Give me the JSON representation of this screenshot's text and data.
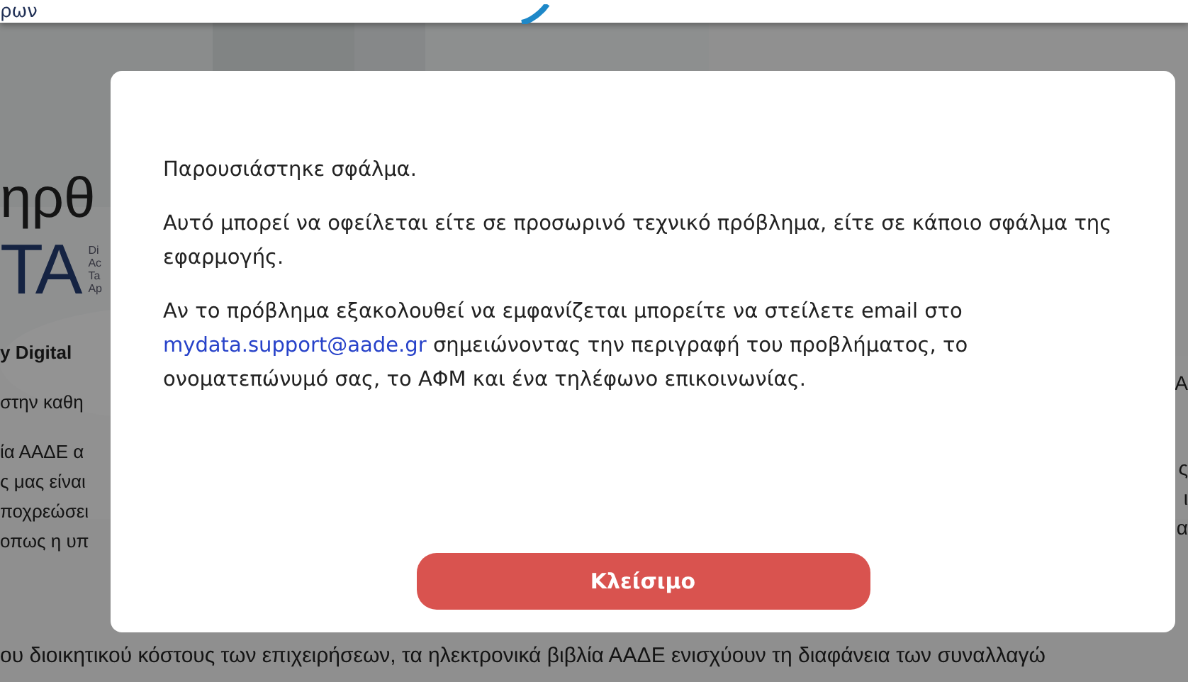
{
  "background_page": {
    "header_text": "ρων",
    "hero": {
      "title_fragment": "ηρθ",
      "logo_fragment": "TA",
      "logo_caption_lines": [
        "Di",
        "Ac",
        "Ta",
        "Ap"
      ]
    },
    "left_groups": [
      {
        "bold": true,
        "lines": [
          "y Digital"
        ]
      },
      {
        "bold": false,
        "lines": [
          "στην καθη"
        ]
      },
      {
        "bold": false,
        "lines": [
          "ία ΑΑΔΕ α",
          "ς μας είναι",
          "ποχρεώσει",
          "οπως η υπ"
        ]
      }
    ],
    "right_lines": [
      "A",
      "ς",
      "ι",
      "α"
    ],
    "bottom_line": "ου διοικητικού κόστους των επιχειρήσεων, τα ηλεκτρονικά βιβλία ΑΑΔΕ ενισχύουν τη διαφάνεια των συναλλαγώ"
  },
  "dialog": {
    "paragraphs": [
      {
        "text": "Παρουσιάστηκε σφάλμα."
      },
      {
        "text": "Αυτό μπορεί να οφείλεται είτε σε προσωρινό τεχνικό πρόβλημα, είτε σε κάποιο σφάλμα της εφαρμογής."
      },
      {
        "text": "Αν το πρόβλημα εξακολουθεί να εμφανίζεται μπορείτε να στείλετε email στο",
        "link": "mydata.support@aade.gr",
        "after": "σημειώνοντας την περιγραφή του προβλήματος, το ονοματεπώνυμό σας, το ΑΦΜ και ένα τηλέφωνο επικοινωνίας."
      }
    ],
    "close_button": "Κλείσιμο"
  }
}
